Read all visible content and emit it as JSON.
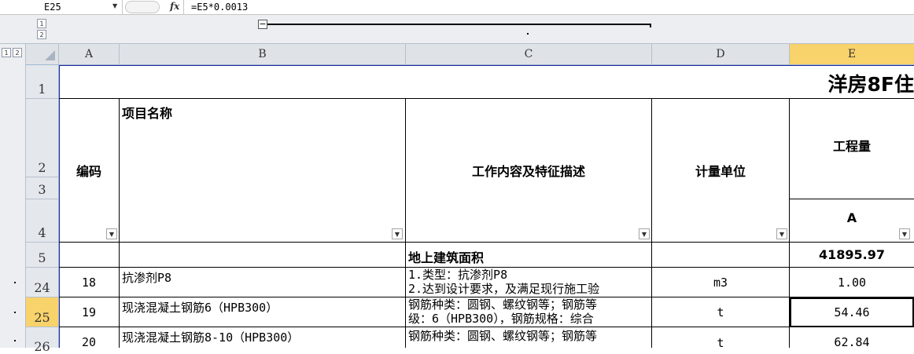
{
  "formula_bar": {
    "name_box": "E25",
    "fx_icon": "fx",
    "formula": "=E5*0.0013"
  },
  "outline": {
    "column_levels": [
      "1",
      "2"
    ],
    "row_levels": [
      "1",
      "2"
    ],
    "collapse_symbol": "−"
  },
  "columns": [
    "A",
    "B",
    "C",
    "D",
    "E"
  ],
  "rows": [
    "1",
    "2",
    "3",
    "4",
    "5",
    "24",
    "25",
    "26"
  ],
  "sheet": {
    "title": "洋房8F住",
    "headers": {
      "code": "编码",
      "item_name": "项目名称",
      "description": "工作内容及特征描述",
      "unit": "计量单位",
      "quantity": "工程量",
      "quantity_sub": "A"
    },
    "summary_row": {
      "label": "地上建筑面积",
      "value": "41895.97"
    },
    "data_rows": [
      {
        "code": "18",
        "name": "抗渗剂P8",
        "desc": "1.类型：抗渗剂P8\n2.达到设计要求，及满足现行施工验",
        "unit": "m3",
        "qty": "1.00"
      },
      {
        "code": "19",
        "name": "现浇混凝土钢筋6（HPB300）",
        "desc": "钢筋种类：圆钢、螺纹钢等；钢筋等\n级：6（HPB300），钢筋规格：综合",
        "unit": "t",
        "qty": "54.46"
      },
      {
        "code": "20",
        "name": "现浇混凝土钢筋8-10（HPB300）",
        "desc": "钢筋种类：圆钢、螺纹钢等；钢筋等",
        "unit": "t",
        "qty": "62.84"
      }
    ]
  },
  "colors": {
    "selected_header": "#f8d26a",
    "header_bg": "#dfe3e8",
    "outline_bg": "#eceef1"
  },
  "icons": {
    "filter": "chevron-down-icon",
    "corner": "select-all-icon"
  }
}
